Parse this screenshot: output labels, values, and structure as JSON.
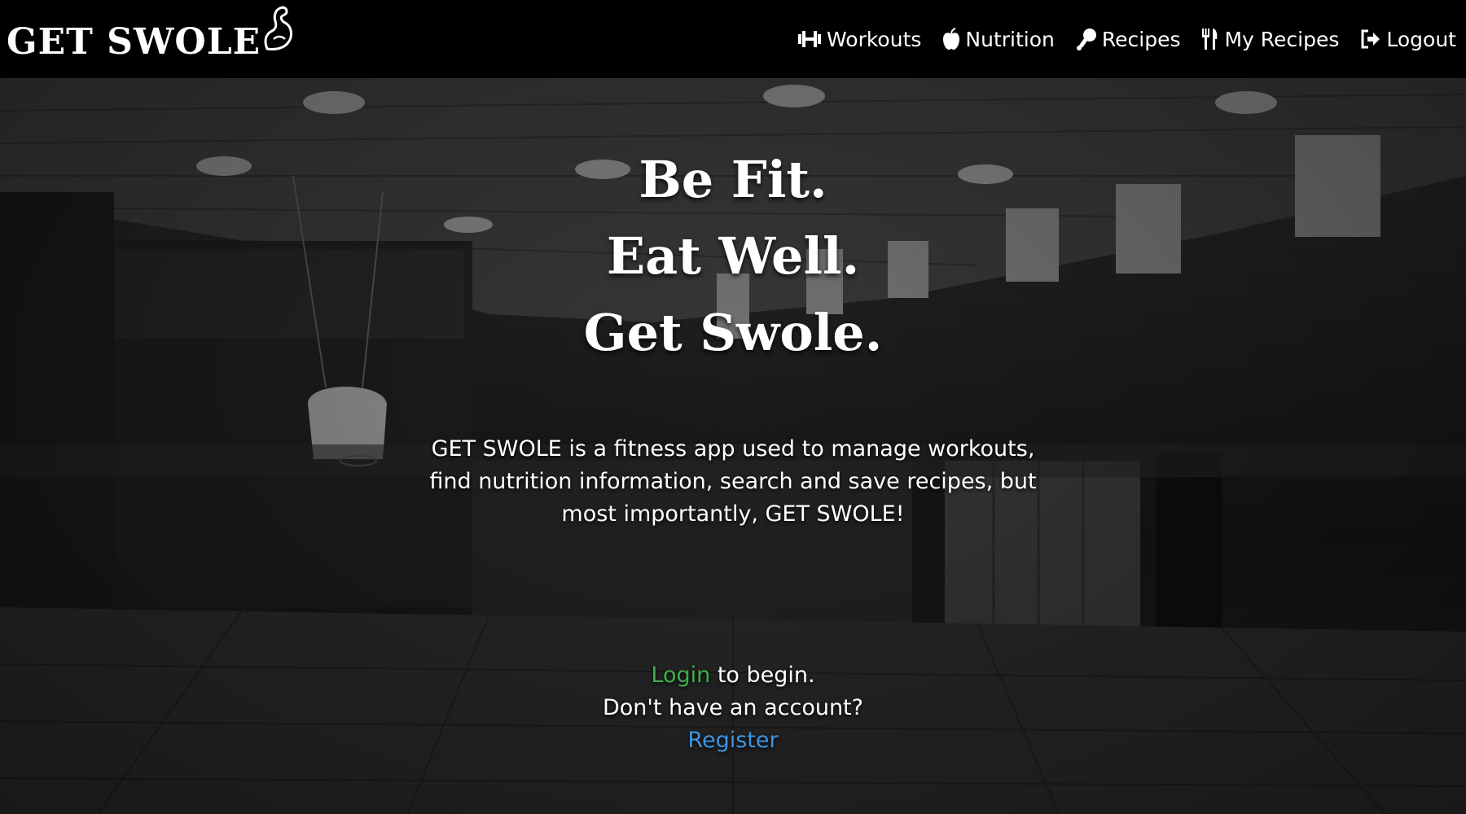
{
  "brand": {
    "name": "GET SWOLE",
    "icon": "flexing-arm-icon"
  },
  "nav": {
    "items": [
      {
        "label": "Workouts",
        "icon": "dumbbell-icon"
      },
      {
        "label": "Nutrition",
        "icon": "apple-icon"
      },
      {
        "label": "Recipes",
        "icon": "drumstick-icon"
      },
      {
        "label": "My Recipes",
        "icon": "fork-knife-icon"
      },
      {
        "label": "Logout",
        "icon": "logout-icon"
      }
    ]
  },
  "hero": {
    "taglines": [
      "Be Fit.",
      "Eat Well.",
      "Get Swole."
    ],
    "description": "GET SWOLE is a fitness app used to manage workouts, find nutrition information, search and save recipes, but most importantly, GET SWOLE!",
    "cta": {
      "login_label": "Login",
      "login_suffix": " to begin.",
      "no_account_text": "Don't have an account?",
      "register_label": "Register"
    }
  },
  "colors": {
    "navbar_bg": "#000000",
    "text": "#ffffff",
    "login_link": "#3fae49",
    "register_link": "#3d95e0"
  }
}
